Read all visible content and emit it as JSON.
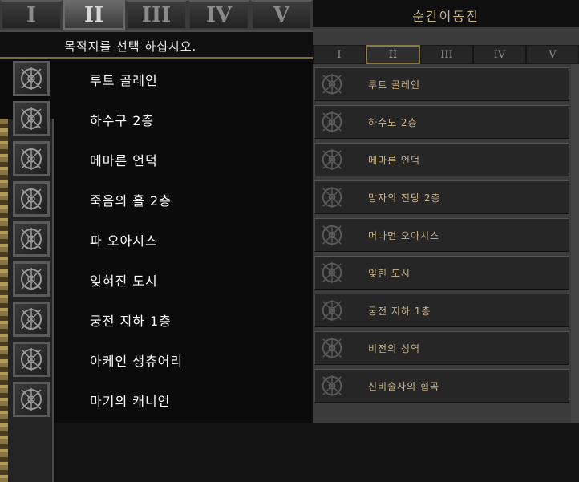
{
  "left": {
    "tabs": [
      "I",
      "II",
      "III",
      "IV",
      "V"
    ],
    "active_tab": 1,
    "header": "목적지를 선택 하십시오.",
    "items": [
      "루트 골레인",
      "하수구 2층",
      "메마른 언덕",
      "죽음의 홀 2층",
      "파 오아시스",
      "잊혀진 도시",
      "궁전 지하 1층",
      "아케인 생츄어리",
      "마기의 캐니언"
    ]
  },
  "right": {
    "title": "순간이동진",
    "tabs": [
      "I",
      "II",
      "III",
      "IV",
      "V"
    ],
    "active_tab": 1,
    "items": [
      "루트 골레인",
      "하수도 2층",
      "메마른 언덕",
      "망자의 전당 2층",
      "머나먼 오아시스",
      "잊힌 도시",
      "궁전 지하 1층",
      "비전의 성역",
      "신비술사의 협곡"
    ]
  },
  "colors": {
    "gold_text": "#c9b48a",
    "white_text": "#ffffff",
    "frame_gold": "#8a7540"
  },
  "icons": {
    "waypoint": "waypoint-rune-icon"
  }
}
